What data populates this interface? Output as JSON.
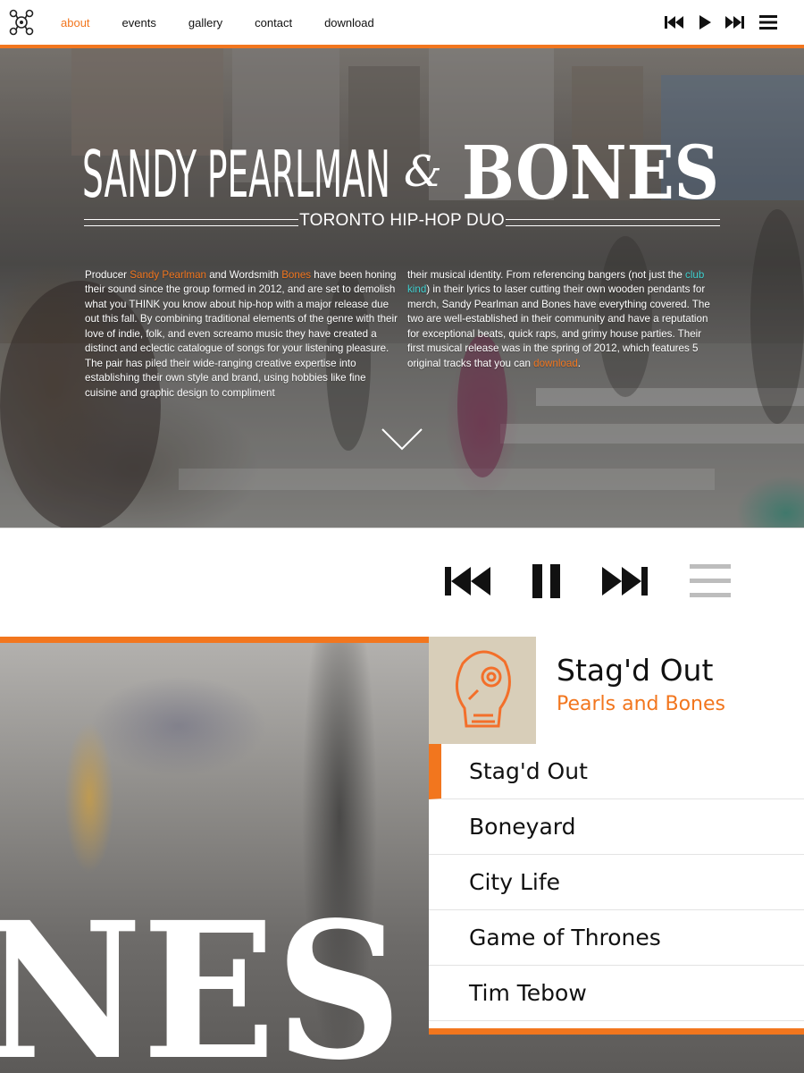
{
  "nav": {
    "links": [
      {
        "label": "about",
        "active": true
      },
      {
        "label": "events"
      },
      {
        "label": "gallery"
      },
      {
        "label": "contact"
      },
      {
        "label": "download"
      }
    ],
    "controls": [
      "previous-icon",
      "play-icon",
      "next-icon",
      "menu-icon"
    ]
  },
  "hero": {
    "title_left": "SANDY PEARLMAN",
    "title_amp": "&",
    "title_right": "BONES",
    "tagline": "TORONTO HIP-HOP DUO",
    "about_left": [
      {
        "t": "Producer "
      },
      {
        "t": "Sandy Pearlman",
        "hl": "orange"
      },
      {
        "t": " and Wordsmith "
      },
      {
        "t": "Bones",
        "hl": "orange"
      },
      {
        "t": " have been honing their sound since the group formed in 2012, and are set to demolish what you THINK you know about hip-hop with a major release due out this fall. By combining traditional elements of the genre with their love of indie, folk, and even screamo music they have created a distinct and eclectic catalogue of songs for your listening pleasure. The pair has piled their wide-ranging creative expertise into establishing their own style and brand, using hobbies like fine cuisine and graphic design to compliment"
      }
    ],
    "about_right": [
      {
        "t": "their musical identity. From referencing bangers (not just the "
      },
      {
        "t": "club kind",
        "hl": "teal"
      },
      {
        "t": ") in their lyrics to laser cutting their own wooden pendants for merch, Sandy Pearlman and Bones have everything covered. The two are well-established in their community and have a reputation for exceptional beats, quick raps, and grimy house parties. Their first musical release was in the spring of 2012, which features 5 original tracks that you can "
      },
      {
        "t": "download",
        "hl": "orange"
      },
      {
        "t": "."
      }
    ]
  },
  "player": {
    "controls": [
      "previous-icon",
      "pause-icon",
      "next-icon",
      "playlist-icon"
    ],
    "now_playing": {
      "title": "Stag'd Out",
      "artist": "Pearls and Bones"
    },
    "tracks": [
      "Stag'd Out",
      "Boneyard",
      "City Life",
      "Game of Thrones",
      "Tim Tebow"
    ],
    "active_track": 0
  },
  "lower": {
    "bg_text": "NES"
  },
  "colors": {
    "accent": "#f2761e",
    "link_teal": "#3fd0cf",
    "text": "#111111"
  }
}
